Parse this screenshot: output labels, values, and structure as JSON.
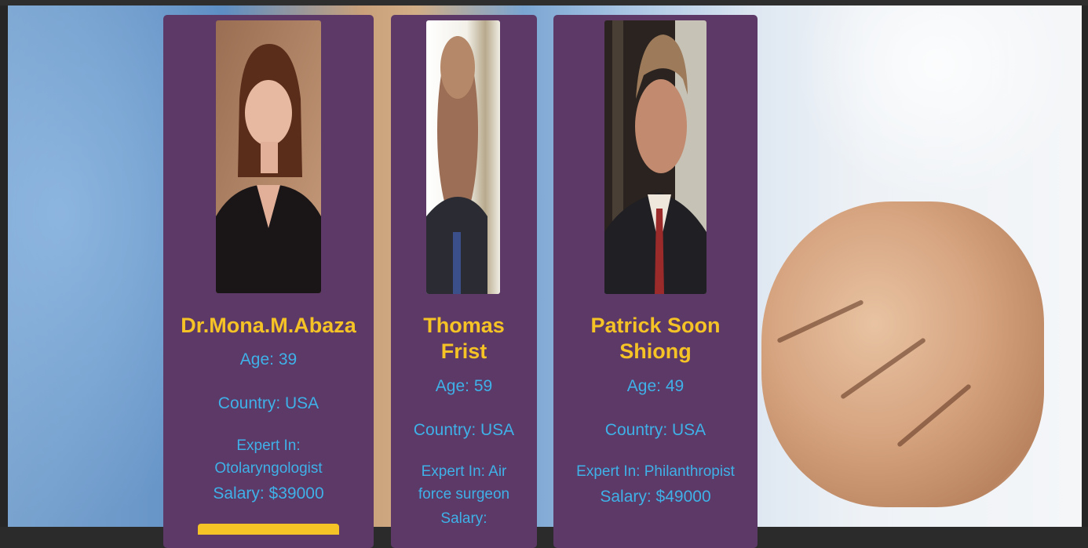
{
  "cards": [
    {
      "name": "Dr.Mona.M.Abaza",
      "age": "Age: 39",
      "country": "Country: USA",
      "expert_line1": "Expert In:",
      "expert_line2": "Otolaryngologist",
      "salary": "Salary: $39000"
    },
    {
      "name_line1": "Thomas",
      "name_line2": "Frist",
      "age": "Age: 59",
      "country": "Country: USA",
      "expert_line1": "Expert In: Air",
      "expert_line2": "force surgeon",
      "salary": "Salary:"
    },
    {
      "name_line1": "Patrick Soon",
      "name_line2": "Shiong",
      "age": "Age: 49",
      "country": "Country: USA",
      "expert_line1": "Expert In: Philanthropist",
      "salary": "Salary: $49000"
    }
  ],
  "colors": {
    "card_bg": "#5c3966",
    "name_color": "#f5c325",
    "text_color": "#3fb1e8",
    "button_color": "#f5c325"
  }
}
